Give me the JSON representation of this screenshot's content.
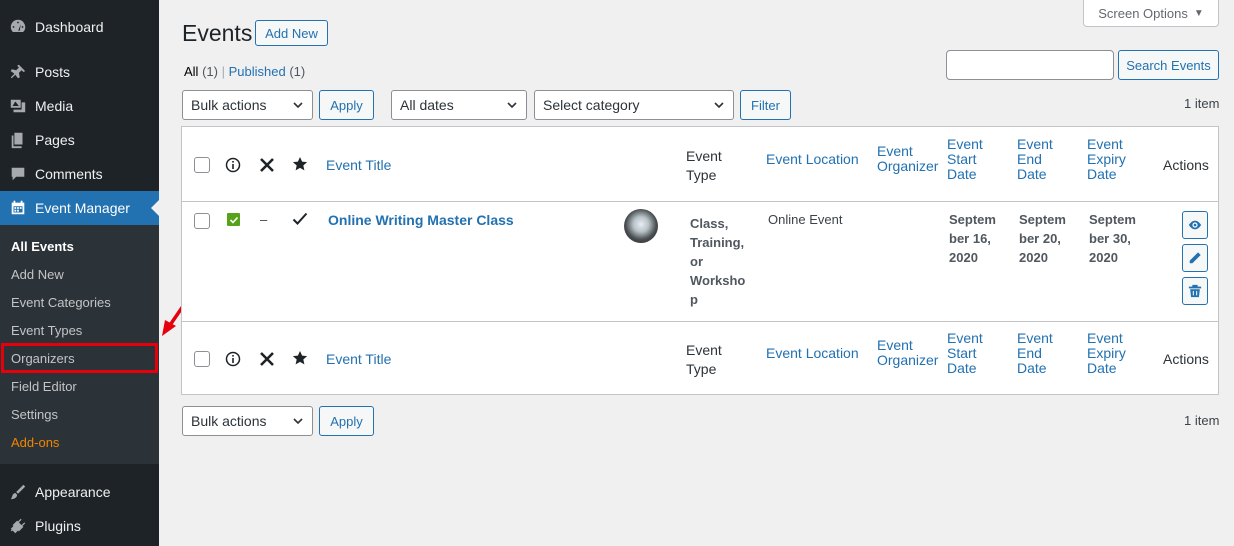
{
  "sidebar": {
    "top_items": [
      {
        "label": "Dashboard",
        "icon": "dashboard-icon"
      },
      {
        "label": "Posts",
        "icon": "pin-icon"
      },
      {
        "label": "Media",
        "icon": "media-icon"
      },
      {
        "label": "Pages",
        "icon": "pages-icon"
      },
      {
        "label": "Comments",
        "icon": "comments-icon"
      },
      {
        "label": "Event Manager",
        "icon": "calendar-icon"
      }
    ],
    "submenu": [
      "All Events",
      "Add New",
      "Event Categories",
      "Event Types",
      "Organizers",
      "Field Editor",
      "Settings",
      "Add-ons"
    ],
    "bottom_items": [
      {
        "label": "Appearance",
        "icon": "brush-icon"
      },
      {
        "label": "Plugins",
        "icon": "plugin-icon"
      }
    ]
  },
  "header": {
    "screen_options": "Screen Options",
    "title": "Events",
    "add_new": "Add New"
  },
  "filters": {
    "all_label": "All",
    "all_count": "(1)",
    "published_label": "Published",
    "published_count": "(1)",
    "bulk_actions": "Bulk actions",
    "apply": "Apply",
    "all_dates": "All dates",
    "select_category": "Select category",
    "filter": "Filter",
    "search_button": "Search Events",
    "items_count": "1 item"
  },
  "table": {
    "columns": {
      "event_title": "Event Title",
      "event_type": [
        "Event",
        "Type"
      ],
      "event_location": "Event Location",
      "event_organizer": [
        "Event",
        "Organizer"
      ],
      "start_date": [
        "Event",
        "Start",
        "Date"
      ],
      "end_date": [
        "Event",
        "End",
        "Date"
      ],
      "expiry_date": [
        "Event",
        "Expiry",
        "Date"
      ],
      "actions": "Actions"
    },
    "rows": [
      {
        "dash": "–",
        "title": "Online Writing Master Class",
        "type_lines": [
          "Class,",
          "Training,",
          "or",
          "Worksho",
          "p"
        ],
        "location": "Online Event",
        "organizer": "",
        "start_lines": [
          "Septem",
          "ber 16,",
          "2020"
        ],
        "end_lines": [
          "Septem",
          "ber 20,",
          "2020"
        ],
        "expiry_lines": [
          "Septem",
          "ber 30,",
          "2020"
        ]
      }
    ]
  },
  "colors": {
    "sidebar_bg": "#1d2327",
    "accent": "#2271b1",
    "highlight": "#e5000b",
    "addons": "#f18500",
    "status_green": "#58a21a"
  }
}
